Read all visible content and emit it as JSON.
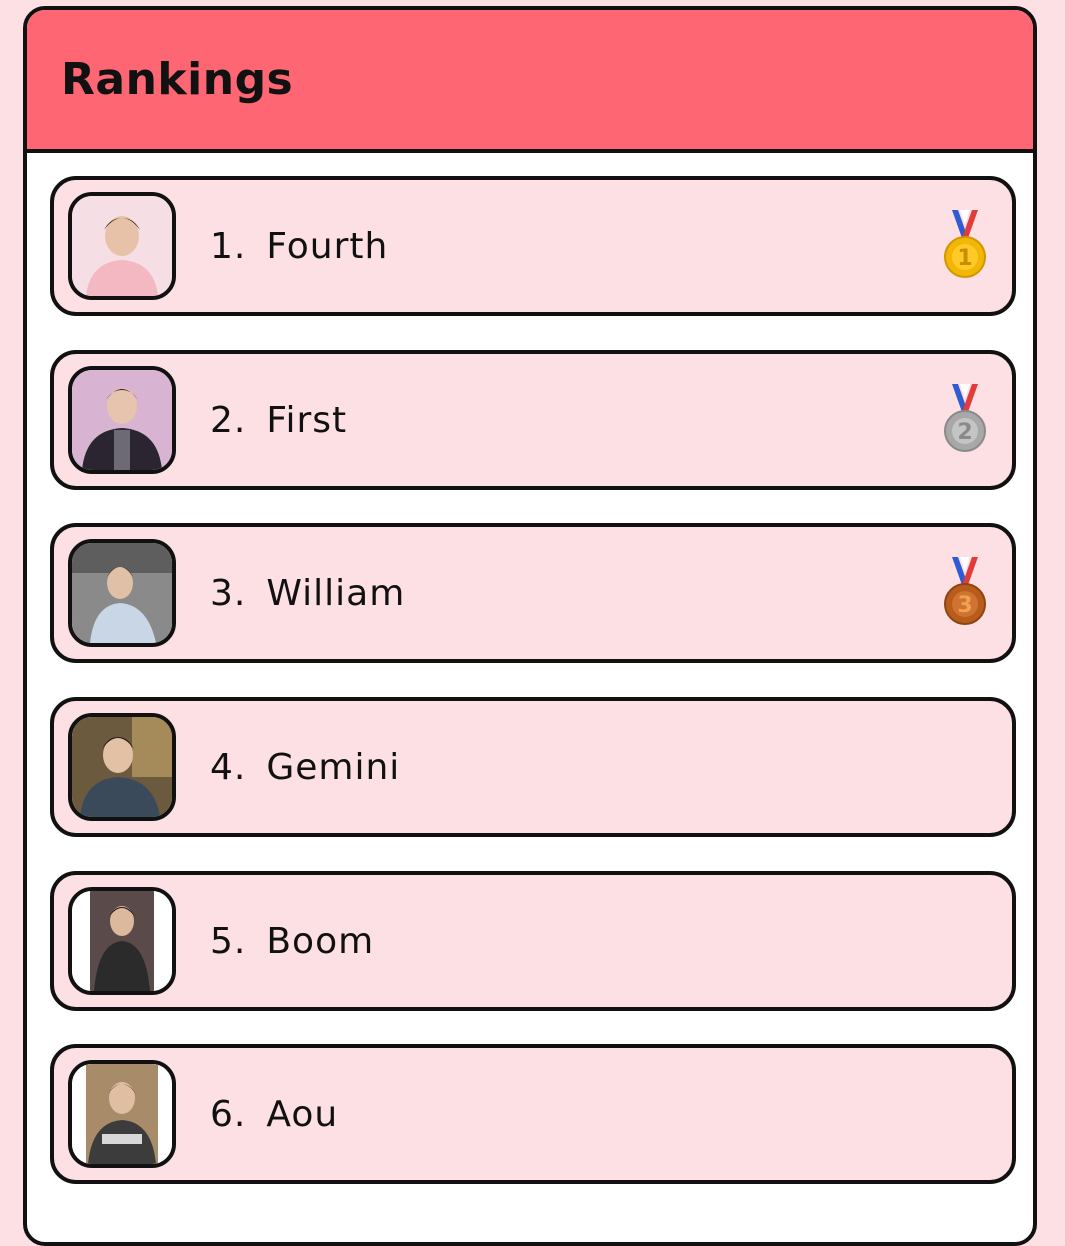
{
  "header": {
    "title": "Rankings"
  },
  "rankings": [
    {
      "number": "1.",
      "name": "Fourth",
      "medal": "gold-medal-icon",
      "medal_color": "#f2b705",
      "medal_label": "1",
      "photo_bg": "#f6dfe4",
      "shirt": "#f3b8c2"
    },
    {
      "number": "2.",
      "name": "First",
      "medal": "silver-medal-icon",
      "medal_color": "#a8a8a8",
      "medal_label": "2",
      "photo_bg": "#d8b4d2",
      "shirt": "#2a2530"
    },
    {
      "number": "3.",
      "name": "William",
      "medal": "bronze-medal-icon",
      "medal_color": "#b85c1c",
      "medal_label": "3",
      "photo_bg": "#8a8a8a",
      "shirt": "#c9d6e6"
    },
    {
      "number": "4.",
      "name": "Gemini",
      "medal": null,
      "photo_bg": "#6b5a3e",
      "shirt": "#3b4a5a"
    },
    {
      "number": "5.",
      "name": "Boom",
      "medal": null,
      "photo_bg": "#5a4a4a",
      "shirt": "#2b2b2b"
    },
    {
      "number": "6.",
      "name": "Aou",
      "medal": null,
      "photo_bg": "#a88c6a",
      "shirt": "#3c3c3c"
    }
  ]
}
